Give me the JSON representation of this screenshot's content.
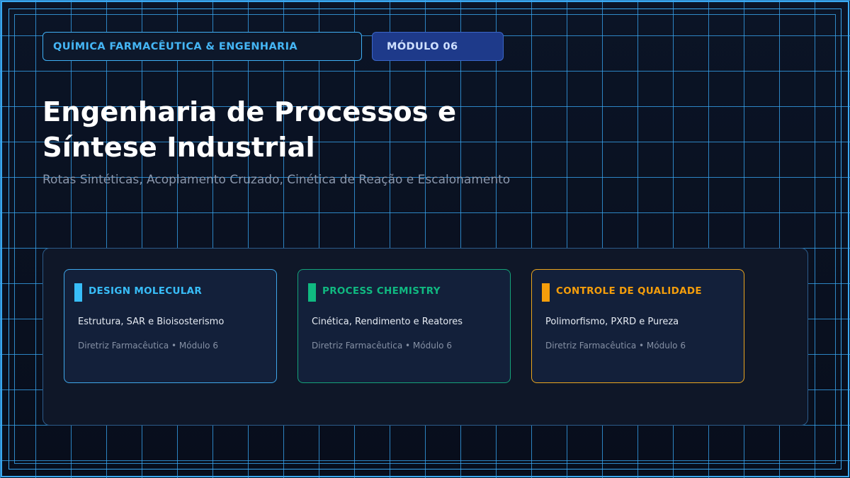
{
  "header": {
    "subject_tag": "QUÍMICA FARMACÊUTICA & ENGENHARIA",
    "module_tag": "MÓDULO 06"
  },
  "hero": {
    "title_line1": "Engenharia de Processos e",
    "title_line2": "Síntese Industrial",
    "subtitle": "Rotas Sintéticas, Acoplamento Cruzado, Cinética de Reação e Escalonamento"
  },
  "colors": {
    "accent_blue": "#38bdf8",
    "accent_green": "#10b981",
    "accent_orange": "#f59e0b",
    "module_tag_bg": "#1e3a8a"
  },
  "cards": [
    {
      "heading": "DESIGN MOLECULAR",
      "description": "Estrutura, SAR e Bioisosterismo",
      "meta": "Diretriz Farmacêutica • Módulo 6"
    },
    {
      "heading": "PROCESS CHEMISTRY",
      "description": "Cinética, Rendimento e Reatores",
      "meta": "Diretriz Farmacêutica • Módulo 6"
    },
    {
      "heading": "CONTROLE DE QUALIDADE",
      "description": "Polimorfismo, PXRD e Pureza",
      "meta": "Diretriz Farmacêutica • Módulo 6"
    }
  ]
}
